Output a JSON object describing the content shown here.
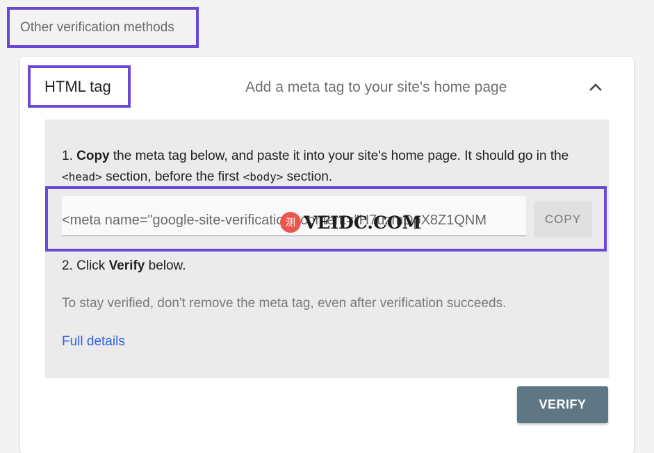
{
  "section": {
    "heading": "Other verification methods"
  },
  "method": {
    "title": "HTML tag",
    "description": "Add a meta tag to your site's home page",
    "expanded_icon": "chevron-up-icon"
  },
  "steps": {
    "step1_num": "1. ",
    "step1_bold": "Copy",
    "step1_text_a": " the meta tag below, and paste it into your site's home page. It should go in the ",
    "step1_code_head": "<head>",
    "step1_text_b": " section, before the first ",
    "step1_code_body": "<body>",
    "step1_text_c": " section.",
    "meta_tag_value": "<meta name=\"google-site-verification\" content=\"H7uzmDpX8Z1QNM",
    "copy_label": "COPY",
    "step2_num": "2. Click ",
    "step2_bold": "Verify",
    "step2_text": " below.",
    "note": "To stay verified, don't remove the meta tag, even after verification succeeds.",
    "full_details_label": "Full details"
  },
  "actions": {
    "verify_label": "VERIFY"
  },
  "watermark": {
    "logo_char": "测",
    "text": "VEIDC.COM"
  },
  "colors": {
    "highlight_border": "#6a47d4",
    "link": "#2d62e0",
    "verify_button": "#5f7784",
    "panel_bg": "#ebebeb"
  }
}
